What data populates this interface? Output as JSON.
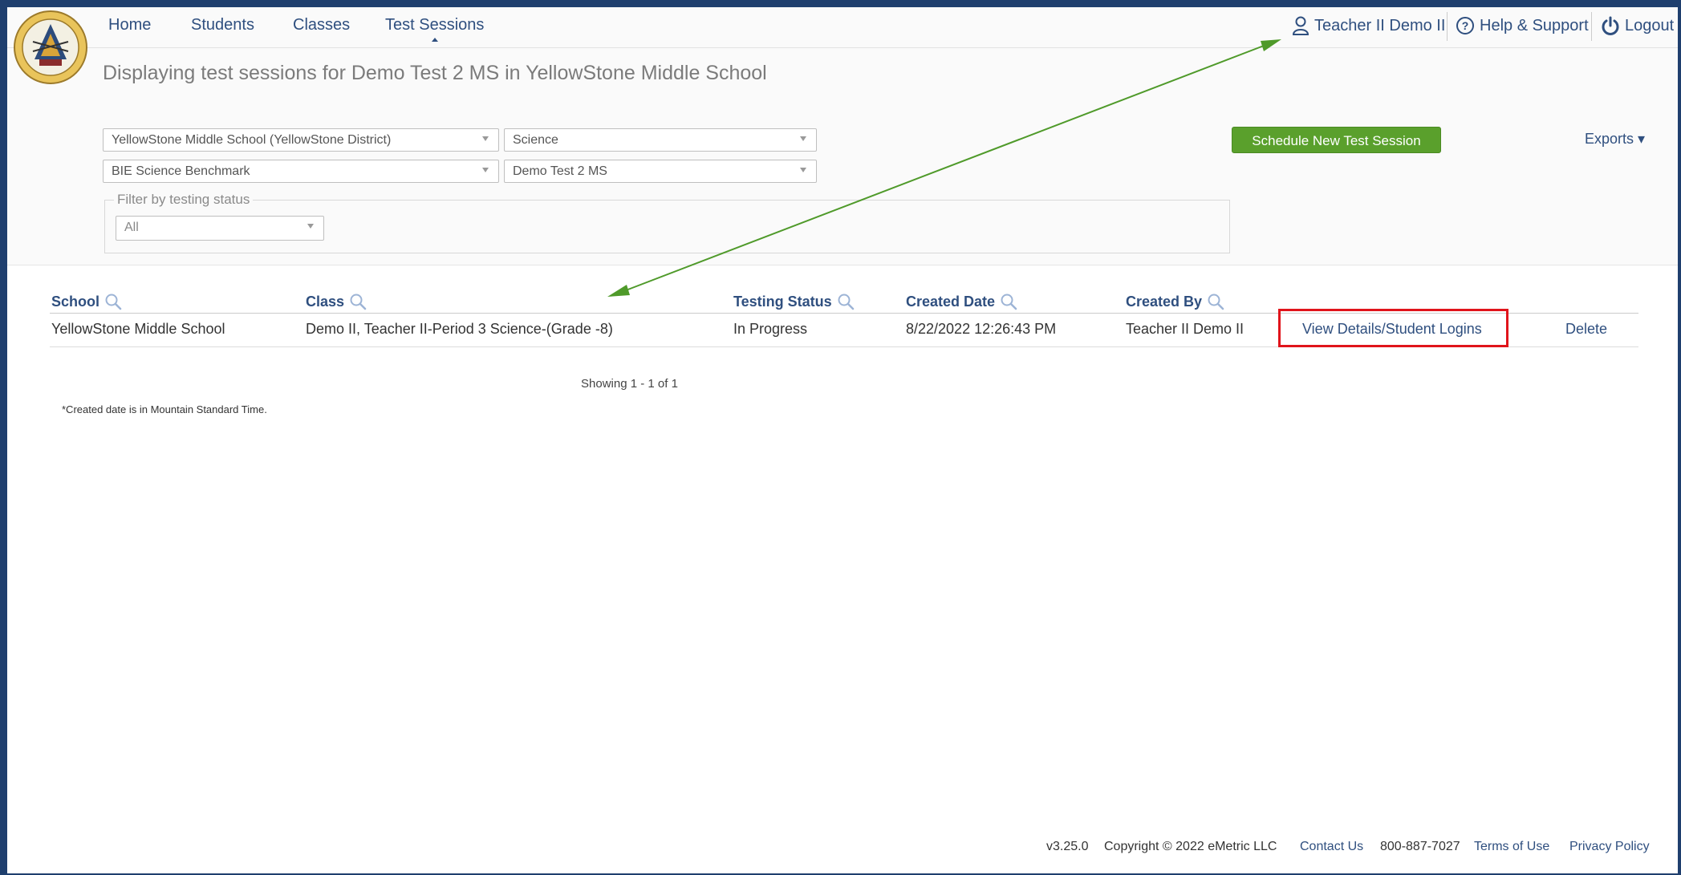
{
  "nav": {
    "home": "Home",
    "students": "Students",
    "classes": "Classes",
    "test_sessions": "Test Sessions",
    "user": "Teacher II Demo II",
    "help": "Help & Support",
    "logout": "Logout"
  },
  "page": {
    "heading": "Displaying test sessions for Demo Test 2 MS in YellowStone Middle School"
  },
  "filters": {
    "school": "YellowStone Middle School (YellowStone District)",
    "subject": "Science",
    "assessment": "BIE Science Benchmark",
    "test": "Demo Test 2 MS",
    "status_legend": "Filter by testing status",
    "status_value": "All"
  },
  "actions": {
    "schedule": "Schedule New Test Session",
    "exports": "Exports ▾"
  },
  "table": {
    "headers": {
      "school": "School",
      "class": "Class",
      "status": "Testing Status",
      "created_date": "Created Date",
      "created_by": "Created By"
    },
    "rows": [
      {
        "school": "YellowStone Middle School",
        "class": "Demo II, Teacher II-Period 3 Science-(Grade -8)",
        "status": "In Progress",
        "created_date": "8/22/2022 12:26:43 PM",
        "created_by": "Teacher II Demo II",
        "view_link": "View Details/Student Logins",
        "delete_link": "Delete"
      }
    ],
    "showing": "Showing 1 - 1 of 1",
    "footnote": "*Created date is in Mountain Standard Time."
  },
  "footer": {
    "version": "v3.25.0",
    "copyright": "Copyright © 2022 eMetric LLC",
    "contact": "Contact Us",
    "phone": "800-887-7027",
    "terms": "Terms of Use",
    "privacy": "Privacy Policy"
  },
  "colors": {
    "accent_green": "#5aa02c",
    "link_blue": "#2f4f7f",
    "highlight_red": "#e0141b",
    "arrow_green": "#4f9a2a"
  },
  "icons": [
    "logo-seal",
    "user-icon",
    "help-icon",
    "power-icon",
    "search-icon",
    "caret-down-icon"
  ]
}
